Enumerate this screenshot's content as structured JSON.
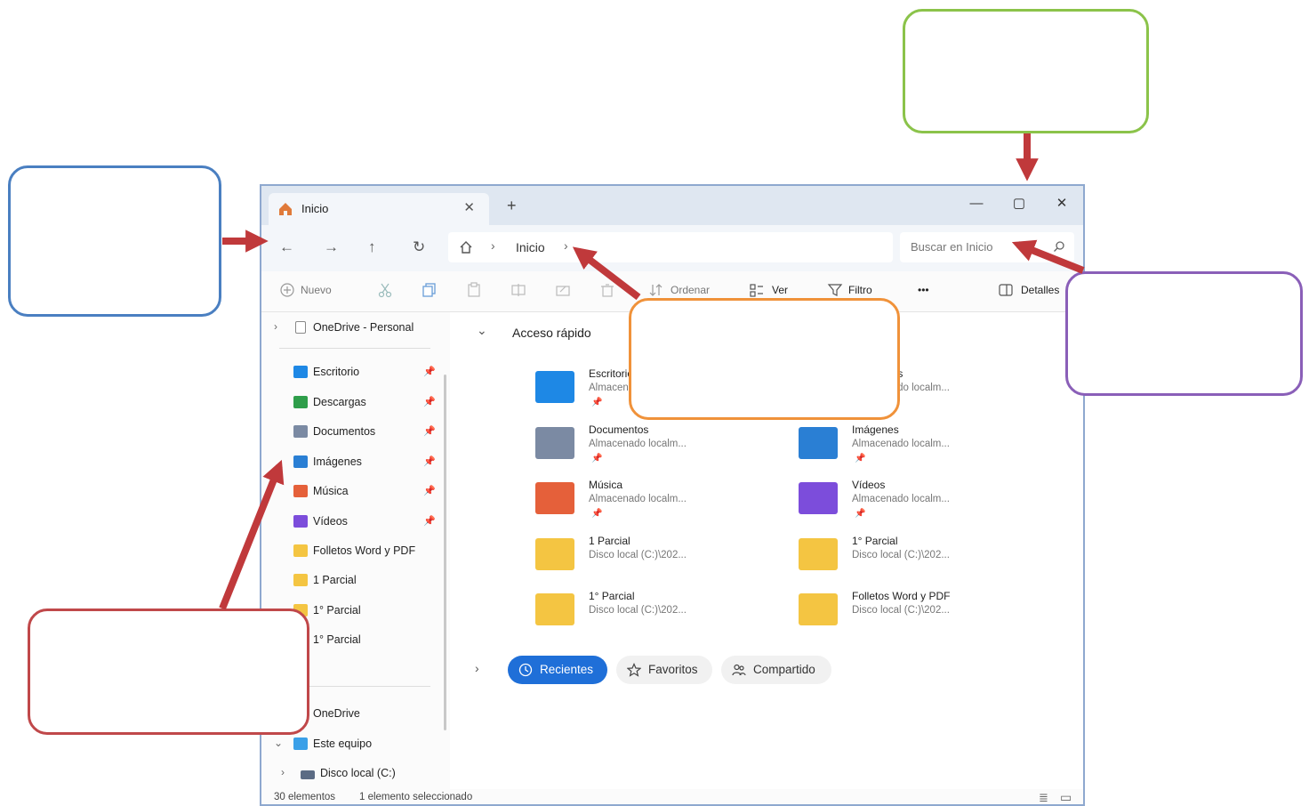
{
  "window": {
    "tab_title": "Inicio",
    "tab_close": "✕",
    "new_tab": "+",
    "minimize": "—",
    "maximize": "▢",
    "close": "✕"
  },
  "nav": {
    "back": "←",
    "forward": "→",
    "up": "↑",
    "refresh": "↻",
    "breadcrumb_sep": "›",
    "breadcrumb": "Inicio",
    "search_placeholder": "Buscar en Inicio"
  },
  "toolbar": {
    "new_label": "Nuevo",
    "sort_label": "Ordenar",
    "view_label": "Ver",
    "filter_label": "Filtro",
    "more_label": "•••",
    "details_label": "Detalles"
  },
  "sidebar": {
    "onedrive_personal": "OneDrive - Personal",
    "items": [
      {
        "label": "Escritorio",
        "icon": "desktop-icon",
        "color": "#1e88e5",
        "pinned": true
      },
      {
        "label": "Descargas",
        "icon": "download-icon",
        "color": "#2e9e4a",
        "pinned": true
      },
      {
        "label": "Documentos",
        "icon": "documents-icon",
        "color": "#7b8aa3",
        "pinned": true
      },
      {
        "label": "Imágenes",
        "icon": "pictures-icon",
        "color": "#2a7fd4",
        "pinned": true
      },
      {
        "label": "Música",
        "icon": "music-icon",
        "color": "#e5603a",
        "pinned": true
      },
      {
        "label": "Vídeos",
        "icon": "videos-icon",
        "color": "#7c4ddb",
        "pinned": true
      },
      {
        "label": "Folletos Word y PDF",
        "icon": "folder-icon",
        "color": "#f4c542",
        "pinned": false
      },
      {
        "label": "1 Parcial",
        "icon": "folder-icon",
        "color": "#f4c542",
        "pinned": false
      },
      {
        "label": "1° Parcial",
        "icon": "folder-icon",
        "color": "#f4c542",
        "pinned": false
      },
      {
        "label": "1° Parcial",
        "icon": "folder-icon",
        "color": "#f4c542",
        "pinned": false
      }
    ],
    "onedrive": "OneDrive",
    "this_pc": "Este equipo",
    "local_disk": "Disco local (C:)"
  },
  "content": {
    "quick_access_title": "Acceso rápido",
    "quick_access": [
      {
        "name": "Escritorio",
        "location": "Almacenado localm...",
        "pinned": true,
        "color": "#1e88e5"
      },
      {
        "name": "Descargas",
        "location": "Almacenado localm...",
        "pinned": true,
        "color": "#2e9e4a"
      },
      {
        "name": "Documentos",
        "location": "Almacenado localm...",
        "pinned": true,
        "color": "#7b8aa3"
      },
      {
        "name": "Imágenes",
        "location": "Almacenado localm...",
        "pinned": true,
        "color": "#2a7fd4"
      },
      {
        "name": "Música",
        "location": "Almacenado localm...",
        "pinned": true,
        "color": "#e5603a"
      },
      {
        "name": "Vídeos",
        "location": "Almacenado localm...",
        "pinned": true,
        "color": "#7c4ddb"
      },
      {
        "name": "1 Parcial",
        "location": "Disco local (C:)\\202...",
        "pinned": false,
        "color": "#f4c542"
      },
      {
        "name": "1° Parcial",
        "location": "Disco local (C:)\\202...",
        "pinned": false,
        "color": "#f4c542"
      },
      {
        "name": "1° Parcial",
        "location": "Disco local (C:)\\202...",
        "pinned": false,
        "color": "#f4c542"
      },
      {
        "name": "Folletos Word y PDF",
        "location": "Disco local (C:)\\202...",
        "pinned": false,
        "color": "#f4c542"
      }
    ],
    "chips": {
      "recent": "Recientes",
      "favorites": "Favoritos",
      "shared": "Compartido"
    }
  },
  "status": {
    "count": "30 elementos",
    "selected": "1 elemento seleccionado"
  },
  "callouts": {
    "blue": "#4a7fc1",
    "green": "#8bc34a",
    "purple": "#8a5fb8",
    "orange": "#f0923a",
    "red": "#c0484a",
    "arrow": "#c0393b"
  }
}
